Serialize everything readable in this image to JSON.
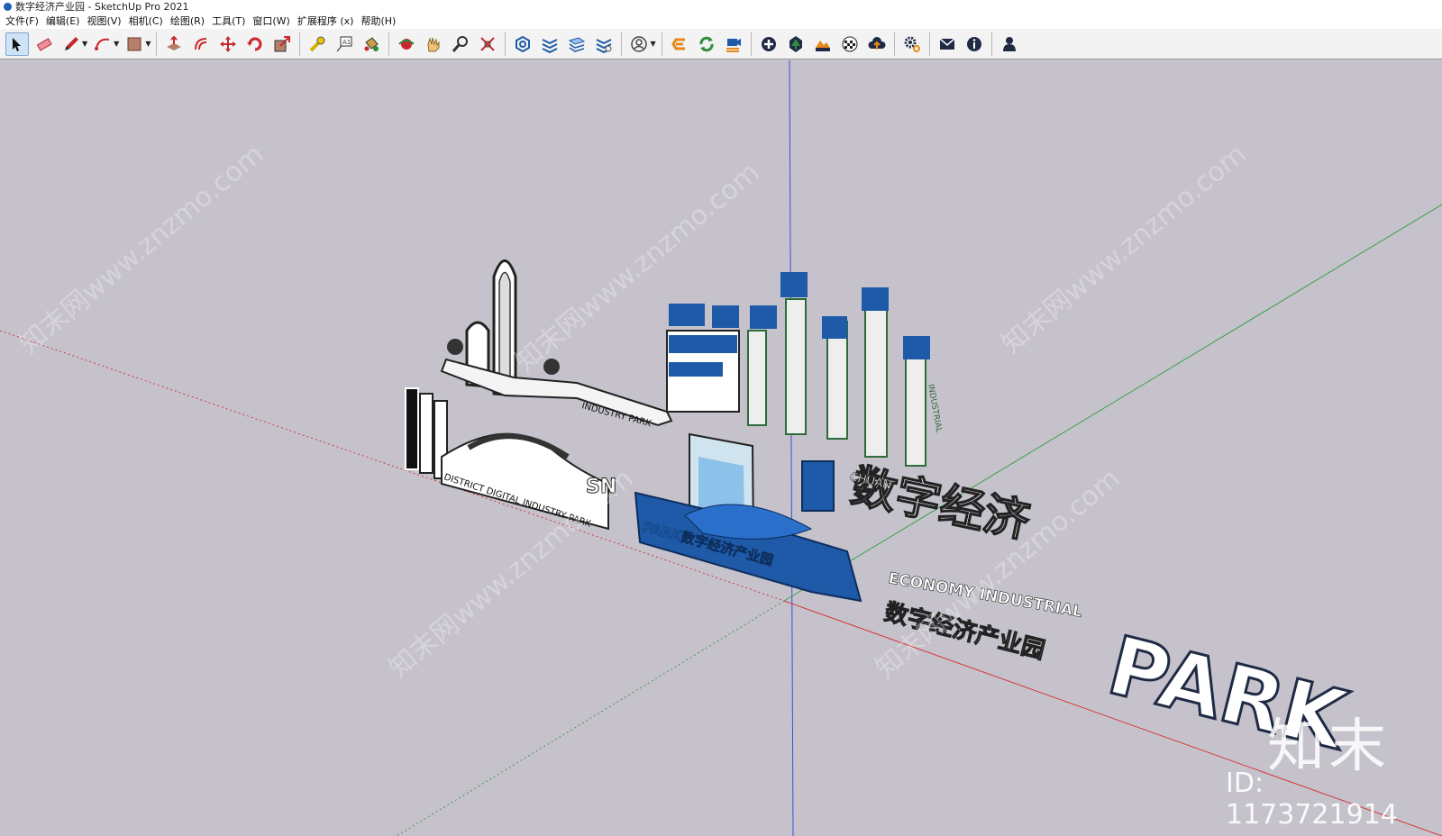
{
  "window": {
    "title": "数字经济产业园 - SketchUp Pro 2021"
  },
  "menu": [
    {
      "label": "文件(F)"
    },
    {
      "label": "编辑(E)"
    },
    {
      "label": "视图(V)"
    },
    {
      "label": "相机(C)"
    },
    {
      "label": "绘图(R)"
    },
    {
      "label": "工具(T)"
    },
    {
      "label": "窗口(W)"
    },
    {
      "label": "扩展程序 (x)"
    },
    {
      "label": "帮助(H)"
    }
  ],
  "toolbar": {
    "groups": [
      [
        "select-icon",
        "eraser-icon",
        "pencil-icon",
        "arc-icon",
        "rectangle-icon"
      ],
      [
        "push-pull-icon",
        "offset-icon",
        "move-icon",
        "rotate-icon",
        "scale-icon"
      ],
      [
        "tape-measure-icon",
        "text-icon",
        "paint-bucket-icon"
      ],
      [
        "orbit-icon",
        "pan-icon",
        "zoom-icon",
        "zoom-extents-icon"
      ],
      [
        "warehouse-icon",
        "layers-icon",
        "styles-icon",
        "tags-icon"
      ],
      [
        "account-icon"
      ],
      [
        "extension-e-icon",
        "refresh-icon",
        "camera-export-icon"
      ],
      [
        "add-circle-icon",
        "tree-icon",
        "terrain-icon",
        "checker-icon",
        "cloud-upload-icon"
      ],
      [
        "settings-icon"
      ],
      [
        "mail-icon",
        "info-icon"
      ],
      [
        "user-icon"
      ]
    ],
    "colors": {
      "accent_blue": "#1e5aa8",
      "accent_red": "#c8282d",
      "accent_green": "#2e8b3d",
      "accent_orange": "#e58a1a"
    }
  },
  "scene": {
    "signs": [
      {
        "text": "数字经济产业园",
        "caption": "INDUSTRY PARK"
      },
      {
        "text": "数字经济产业园",
        "caption": "PARK",
        "side": "INDUSTRIAL"
      },
      {
        "text": "数字经济产业园",
        "caption": "DISTRICT DIGITAL INDUSTRY PARK",
        "letters": "SN"
      },
      {
        "text": "PARK数字经济产业园"
      },
      {
        "text": "数字经济",
        "caption": "CHUAN"
      },
      {
        "text": "数字经济产业园",
        "caption": "ECONOMY INDUSTRIAL",
        "big": "PARK"
      }
    ],
    "axis_colors": {
      "blue": "#3b4fd6",
      "green": "#3aa04a",
      "red": "#d23a3a"
    }
  },
  "watermark": {
    "brand": "知末",
    "id": "ID: 1173721914",
    "repeat": "知末网www.znzmo.com"
  }
}
